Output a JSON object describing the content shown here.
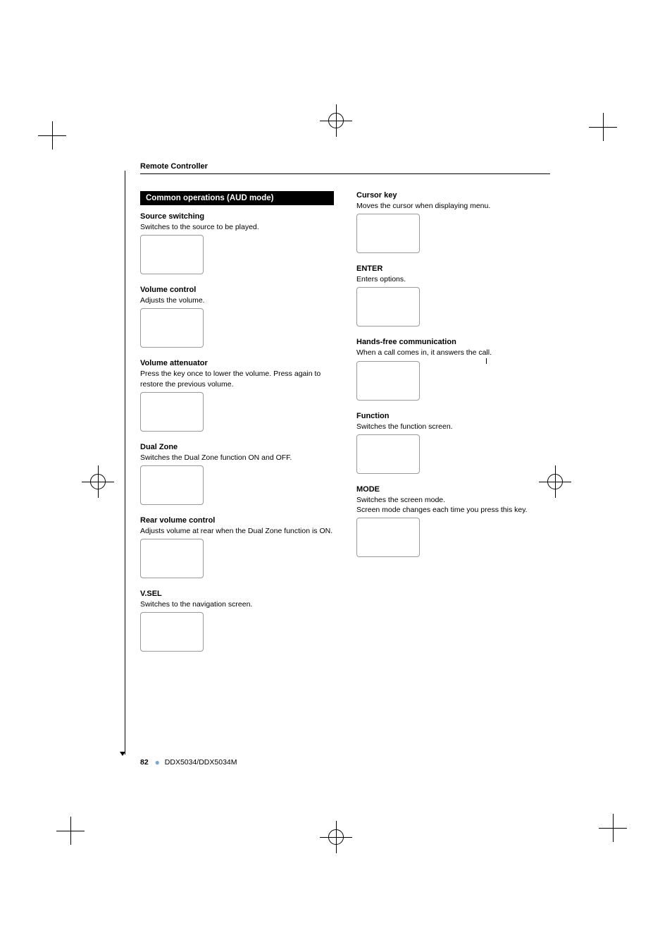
{
  "header": {
    "running_head": "Remote Controller"
  },
  "left": {
    "band": "Common operations (AUD mode)",
    "items": [
      {
        "title": "Source switching",
        "text": "Switches to the source to be played."
      },
      {
        "title": "Volume control",
        "text": "Adjusts the volume."
      },
      {
        "title": "Volume attenuator",
        "text": "Press the key once to lower the volume. Press again to restore the previous volume."
      },
      {
        "title": "Dual Zone",
        "text": "Switches the Dual Zone function ON and OFF."
      },
      {
        "title": "Rear volume control",
        "text": "Adjusts volume at rear when the Dual Zone function is ON."
      },
      {
        "title": "V.SEL",
        "text": "Switches to the navigation screen."
      }
    ]
  },
  "right": {
    "items": [
      {
        "title": "Cursor key",
        "text": "Moves the cursor when displaying menu."
      },
      {
        "title": "ENTER",
        "text": "Enters options."
      },
      {
        "title": "Hands-free communication",
        "text": "When a call comes in, it answers the call."
      },
      {
        "title": "Function",
        "text": "Switches the function screen."
      },
      {
        "title": "MODE",
        "text": "Switches the screen mode.\nScreen mode changes each time you press this key."
      }
    ]
  },
  "footer": {
    "page": "82",
    "model": "DDX5034/DDX5034M"
  },
  "fig_placeholder": ""
}
